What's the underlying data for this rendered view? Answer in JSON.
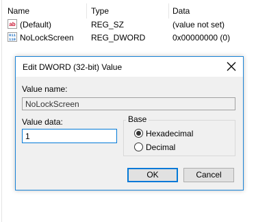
{
  "list": {
    "columns": [
      "Name",
      "Type",
      "Data"
    ],
    "rows": [
      {
        "name": "(Default)",
        "type": "REG_SZ",
        "data": "(value not set)",
        "icon": "string-value-icon"
      },
      {
        "name": "NoLockScreen",
        "type": "REG_DWORD",
        "data": "0x00000000 (0)",
        "icon": "binary-value-icon"
      }
    ]
  },
  "dialog": {
    "title": "Edit DWORD (32-bit) Value",
    "value_name_label": "Value name:",
    "value_name": "NoLockScreen",
    "value_data_label": "Value data:",
    "value_data": "1",
    "base_label": "Base",
    "base_options": [
      {
        "label": "Hexadecimal",
        "selected": true
      },
      {
        "label": "Decimal",
        "selected": false
      }
    ],
    "ok_label": "OK",
    "cancel_label": "Cancel"
  },
  "colors": {
    "accent": "#0078d7",
    "icon_red": "#c8102e",
    "icon_blue": "#1e6fc2"
  }
}
